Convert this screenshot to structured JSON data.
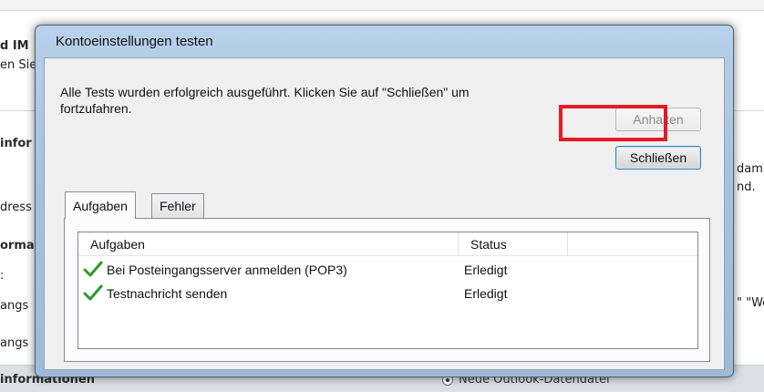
{
  "background": {
    "left_fragments": [
      "d IM",
      "en Sie",
      "infor",
      "dress",
      "orma",
      ":",
      "angs",
      "angs"
    ],
    "footer_left": "informationen",
    "right_fragments": [
      "dami",
      "nd.",
      "\" \"We"
    ],
    "footer_right": "Neue Outlook-Datendatei"
  },
  "dialog": {
    "title": "Kontoeinstellungen testen",
    "message": "Alle Tests wurden erfolgreich ausgeführt. Klicken Sie auf \"Schließen\" um fortzufahren.",
    "stop_label": "Anhalten",
    "close_label": "Schließen",
    "tabs": [
      {
        "label": "Aufgaben",
        "active": true
      },
      {
        "label": "Fehler",
        "active": false
      }
    ],
    "columns": [
      "Aufgaben",
      "Status"
    ],
    "rows": [
      {
        "task": "Bei Posteingangsserver anmelden (POP3)",
        "status": "Erledigt"
      },
      {
        "task": "Testnachricht senden",
        "status": "Erledigt"
      }
    ],
    "row_icon": "green-checkmark-icon",
    "highlight_color": "#e41a26"
  }
}
